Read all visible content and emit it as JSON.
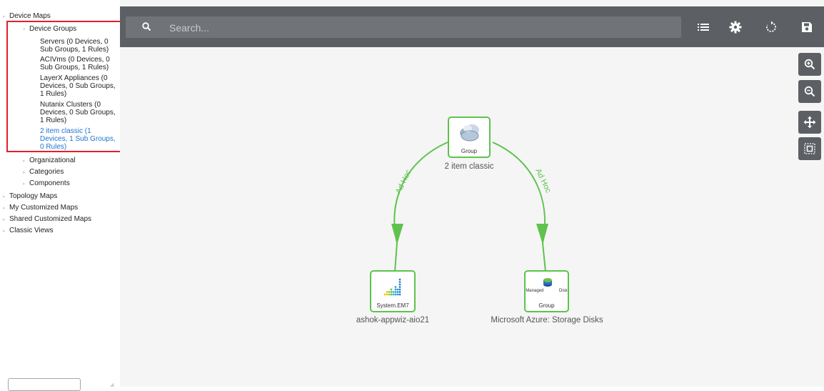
{
  "sidebar": {
    "tree": {
      "device_maps": "Device Maps",
      "device_groups": "Device Groups",
      "groups": [
        {
          "line1": "Servers (0 Devices, 0",
          "line2": "Sub Groups, 1 Rules)"
        },
        {
          "line1": "ACIVms (0 Devices, 0",
          "line2": "Sub Groups, 1 Rules)"
        },
        {
          "line1": "LayerX Appliances (0",
          "line2": "Devices, 0 Sub Groups,",
          "line3": "1 Rules)"
        },
        {
          "line1": "Nutanix Clusters (0",
          "line2": "Devices, 0 Sub Groups,",
          "line3": "1 Rules)"
        },
        {
          "line1": "2 item classic (1",
          "line2": "Devices, 1 Sub Groups,",
          "line3": "0 Rules)"
        }
      ],
      "organizational": "Organizational",
      "categories": "Categories",
      "components": "Components",
      "topology_maps": "Topology Maps",
      "my_customized_maps": "My Customized Maps",
      "shared_customized_maps": "Shared Customized Maps",
      "classic_views": "Classic Views"
    }
  },
  "toolbar": {
    "search_placeholder": "Search...",
    "icons": [
      "search-icon",
      "list-icon",
      "gear-icon",
      "refresh-icon",
      "save-icon"
    ]
  },
  "zoom_controls": [
    "zoom-in-icon",
    "zoom-out-icon",
    "move-icon",
    "fit-to-screen-icon"
  ],
  "graph": {
    "nodes": [
      {
        "type_label": "Group",
        "name": "2 item classic",
        "icon": "cloud-group-icon"
      },
      {
        "type_label": "System.EM7",
        "name": "ashok-appwiz-aio21",
        "icon": "em7-dots-icon"
      },
      {
        "type_label": "Group",
        "badge": "Managed Disk",
        "name": "Microsoft Azure: Storage Disks",
        "icon": "managed-disk-icon"
      }
    ],
    "edges": [
      {
        "label": "Ad Hoc"
      },
      {
        "label": "Ad Hoc"
      }
    ]
  },
  "colors": {
    "toolbar_bg": "#5c5f63",
    "canvas_bg": "#f5f5f5",
    "edge_green": "#5dc34d",
    "highlight_red": "#e2202b",
    "selected_link": "#1f73d1"
  }
}
